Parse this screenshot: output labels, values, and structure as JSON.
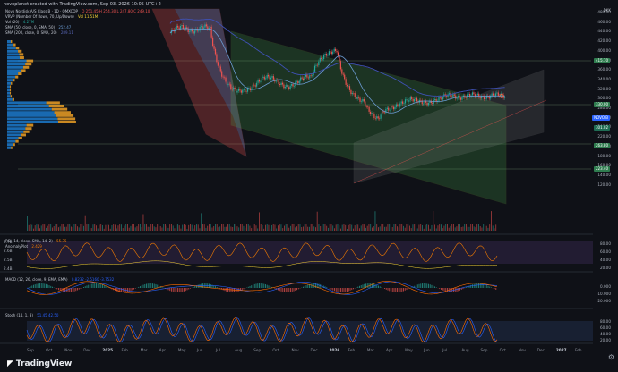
{
  "header": {
    "title": "novoplanet created with TradingView.com, Sep 03, 2026 10:05 UTC+2",
    "ticker_tag": "DKK"
  },
  "legend": {
    "symbol": "Novo Nordisk A/S Class B · 1D · OMXCOP",
    "ohlc": "O 251.45  H 254.30  L 247.80  C 249.10",
    "vrvp": "VRVP (Number Of Rows, 70, Up/Down)",
    "vrvp_val": "Vol 11.51M",
    "vol": "Vol (20)",
    "vol_val": "4.27M",
    "sma50": "SMA (50, close, 0, SMA, 50)",
    "sma50_val": "252.47",
    "sma200": "SMA (200, close, 0, SMA, 20)",
    "sma200_val": "289.11"
  },
  "price_axis": {
    "labels": [
      "480.00",
      "460.00",
      "440.00",
      "420.00",
      "400.00",
      "380.00",
      "360.00",
      "340.00",
      "320.00",
      "300.00",
      "280.00",
      "260.00",
      "240.00",
      "220.00",
      "200.00",
      "180.00",
      "160.00",
      "140.00",
      "120.00"
    ],
    "tags": [
      {
        "text": "415.70",
        "color": "#2f7d4f"
      },
      {
        "text": "330.00",
        "color": "#2f7d4f"
      },
      {
        "text": "NOVO B",
        "color": "#2962ff"
      },
      {
        "text": "301.02",
        "color": "#1f6d54"
      },
      {
        "text": "263.80",
        "color": "#2f7d4f"
      },
      {
        "text": "223.40",
        "color": "#2f7d4f"
      }
    ]
  },
  "rsi": {
    "label": "RSI (14, close, SMA, 14, 2)",
    "val": "55.35",
    "sub": "AnomalyPlot",
    "sub_val": "2.429",
    "axis": [
      "2.7B",
      "2.6B",
      "2.5B",
      "2.4B"
    ],
    "right": [
      "80.00",
      "60.00",
      "40.00",
      "20.00"
    ]
  },
  "macd": {
    "label": "MACD (12, 26, close, 9, EMA, EMA)",
    "vals": "0.8232  -2.5160  -3.7532",
    "right": [
      "0.000",
      "-10.000",
      "-20.000"
    ]
  },
  "stoch": {
    "label": "Stoch (14, 1, 3)",
    "vals": "51.45  42.50",
    "right": [
      "80.00",
      "60.00",
      "40.00",
      "20.00"
    ]
  },
  "time_axis": [
    "Sep",
    "Oct",
    "Nov",
    "Dec",
    "2025",
    "Feb",
    "Mar",
    "Apr",
    "May",
    "Jun",
    "Jul",
    "Aug",
    "Sep",
    "Oct",
    "Nov",
    "Dec",
    "2026",
    "Feb",
    "Mar",
    "Apr",
    "May",
    "Jun",
    "Jul",
    "Aug",
    "Sep",
    "Oct",
    "Nov",
    "Dec",
    "2027",
    "Feb"
  ],
  "brand": "TradingView",
  "colors": {
    "bull": "#26a69a",
    "bear": "#ef5350",
    "sma50": "#6b9bd2",
    "sma200": "#3f51b5",
    "channel_green": "#4caf50",
    "channel_red": "#ef5350",
    "rsi": "#f57c00",
    "macd_line": "#2962ff",
    "macd_signal": "#ff6d00",
    "stoch_k": "#2962ff",
    "stoch_d": "#ff6d00"
  }
}
